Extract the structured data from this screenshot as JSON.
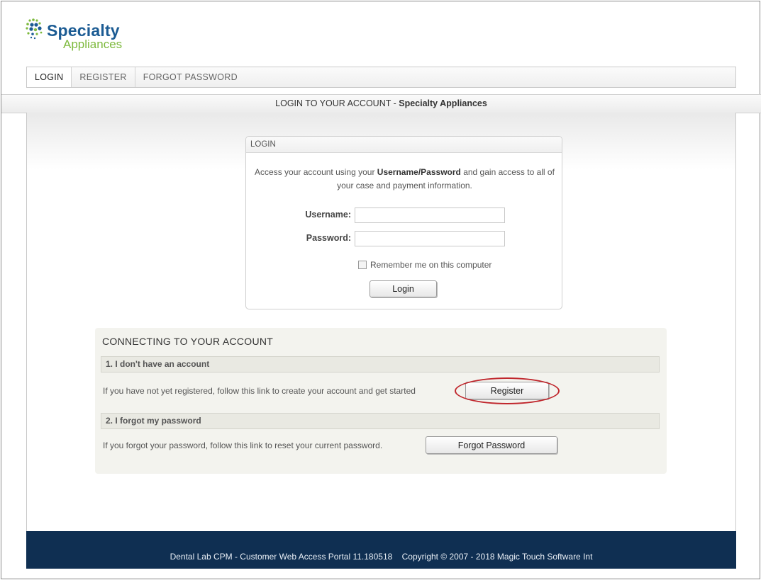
{
  "logo": {
    "name": "Specialty",
    "sub": "Appliances"
  },
  "nav": {
    "items": [
      "LOGIN",
      "REGISTER",
      "FORGOT PASSWORD"
    ]
  },
  "page_title": {
    "prefix": "LOGIN TO YOUR ACCOUNT - ",
    "brand": "Specialty Appliances"
  },
  "login": {
    "header": "LOGIN",
    "desc_1": "Access your account using your ",
    "desc_bold": "Username/Password",
    "desc_2": " and gain access to all of your case and payment information.",
    "username_label": "Username:",
    "username_value": "",
    "password_label": "Password:",
    "password_value": "",
    "remember_label": "Remember me on this computer",
    "remember_checked": false,
    "login_button": "Login"
  },
  "connect": {
    "title": "CONNECTING TO YOUR ACCOUNT",
    "section1_head": "1. I don't have an account",
    "section1_text": "If you have not yet registered, follow this link to create your account and get started",
    "register_button": "Register",
    "section2_head": "2. I forgot my password",
    "section2_text": "If you forgot your password, follow this link to reset your current password.",
    "forgot_button": "Forgot Password"
  },
  "footer": {
    "product": "Dental Lab CPM - Customer Web Access Portal 11.180518",
    "copyright": "Copyright © 2007 - 2018 Magic Touch Software Int"
  },
  "colors": {
    "brand_blue": "#1b5b93",
    "brand_green": "#7db93d",
    "footer_bg": "#0f2f52",
    "highlight_oval": "#c0272d"
  },
  "icons": {
    "logo_mark": "dot-cluster-icon"
  }
}
